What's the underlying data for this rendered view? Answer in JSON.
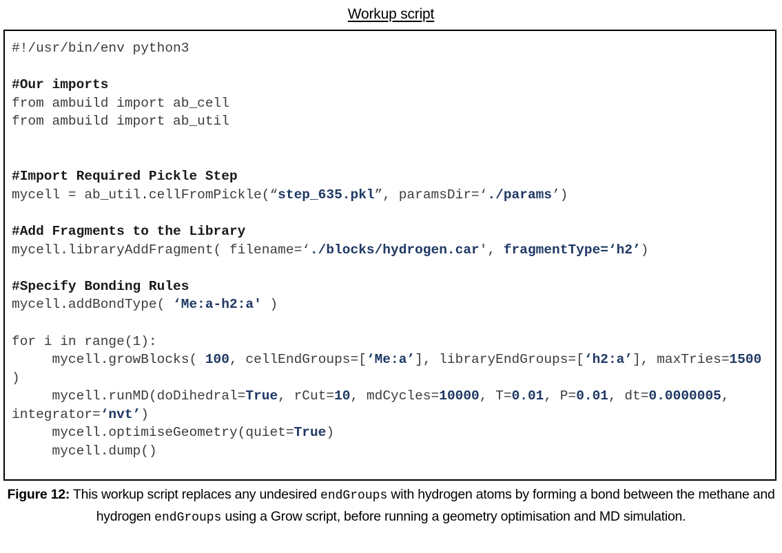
{
  "title": {
    "text": "Workup script"
  },
  "colors": {
    "highlight": "#1f3864",
    "code_text": "#3c3c3c",
    "comment": "#1a1a1a",
    "border": "#000000",
    "background": "#ffffff"
  },
  "code": {
    "language": "python",
    "lines": [
      {
        "id": "shebang",
        "segments": [
          {
            "t": "#!/usr/bin/env python3",
            "s": "plain"
          }
        ]
      },
      {
        "id": "blank-1",
        "segments": []
      },
      {
        "id": "comment-imports",
        "segments": [
          {
            "t": "#Our imports",
            "s": "comment"
          }
        ]
      },
      {
        "id": "import-ab-cell",
        "segments": [
          {
            "t": "from ambuild import ab_cell",
            "s": "plain"
          }
        ]
      },
      {
        "id": "import-ab-util",
        "segments": [
          {
            "t": "from ambuild import ab_util",
            "s": "plain"
          }
        ]
      },
      {
        "id": "blank-2",
        "segments": []
      },
      {
        "id": "blank-3",
        "segments": []
      },
      {
        "id": "comment-pickle",
        "segments": [
          {
            "t": "#Import Required Pickle Step",
            "s": "comment"
          }
        ]
      },
      {
        "id": "cell-from-pickle",
        "segments": [
          {
            "t": "mycell = ab_util.cellFromPickle(“",
            "s": "plain"
          },
          {
            "t": "step_635.pkl",
            "s": "highlight"
          },
          {
            "t": "”, paramsDir=‘",
            "s": "plain"
          },
          {
            "t": "./params",
            "s": "highlight"
          },
          {
            "t": "’)",
            "s": "plain"
          }
        ]
      },
      {
        "id": "blank-4",
        "segments": []
      },
      {
        "id": "comment-fragments",
        "segments": [
          {
            "t": "#Add Fragments to the Library",
            "s": "comment"
          }
        ]
      },
      {
        "id": "library-add-fragment",
        "segments": [
          {
            "t": "mycell.libraryAddFragment( filename=‘",
            "s": "plain"
          },
          {
            "t": "./blocks/hydrogen.car",
            "s": "highlight"
          },
          {
            "t": "', ",
            "s": "plain"
          },
          {
            "t": "fragmentType=‘h2’",
            "s": "highlight"
          },
          {
            "t": ")",
            "s": "plain"
          }
        ]
      },
      {
        "id": "blank-5",
        "segments": []
      },
      {
        "id": "comment-bonding",
        "segments": [
          {
            "t": "#Specify Bonding Rules",
            "s": "comment"
          }
        ]
      },
      {
        "id": "add-bond-type",
        "segments": [
          {
            "t": "mycell.addBondType( ",
            "s": "plain"
          },
          {
            "t": "‘Me:a-h2:a'",
            "s": "highlight"
          },
          {
            "t": " )",
            "s": "plain"
          }
        ]
      },
      {
        "id": "blank-6",
        "segments": []
      },
      {
        "id": "for-loop",
        "segments": [
          {
            "t": "for i in range(1):",
            "s": "plain"
          }
        ]
      },
      {
        "id": "grow-blocks",
        "segments": [
          {
            "t": "     mycell.growBlocks( ",
            "s": "plain"
          },
          {
            "t": "100",
            "s": "highlight"
          },
          {
            "t": ", cellEndGroups=[",
            "s": "plain"
          },
          {
            "t": "‘Me:a’",
            "s": "highlight"
          },
          {
            "t": "], libraryEndGroups=[",
            "s": "plain"
          },
          {
            "t": "‘h2:a’",
            "s": "highlight"
          },
          {
            "t": "], maxTries=",
            "s": "plain"
          },
          {
            "t": "1500",
            "s": "highlight"
          },
          {
            "t": " )",
            "s": "plain"
          }
        ]
      },
      {
        "id": "run-md",
        "segments": [
          {
            "t": "     mycell.runMD(doDihedral=",
            "s": "plain"
          },
          {
            "t": "True",
            "s": "highlight"
          },
          {
            "t": ", rCut=",
            "s": "plain"
          },
          {
            "t": "10",
            "s": "highlight"
          },
          {
            "t": ", mdCycles=",
            "s": "plain"
          },
          {
            "t": "10000",
            "s": "highlight"
          },
          {
            "t": ", T=",
            "s": "plain"
          },
          {
            "t": "0.01",
            "s": "highlight"
          },
          {
            "t": ", P=",
            "s": "plain"
          },
          {
            "t": "0.01",
            "s": "highlight"
          },
          {
            "t": ", dt=",
            "s": "plain"
          },
          {
            "t": "0.0000005",
            "s": "highlight"
          },
          {
            "t": ", integrator=",
            "s": "plain"
          },
          {
            "t": "‘nvt’",
            "s": "highlight"
          },
          {
            "t": ")",
            "s": "plain"
          }
        ]
      },
      {
        "id": "optimise-geometry",
        "segments": [
          {
            "t": "     mycell.optimiseGeometry(quiet=",
            "s": "plain"
          },
          {
            "t": "True",
            "s": "highlight"
          },
          {
            "t": ")",
            "s": "plain"
          }
        ]
      },
      {
        "id": "dump",
        "segments": [
          {
            "t": "     mycell.dump()",
            "s": "plain"
          }
        ]
      }
    ]
  },
  "caption": {
    "segments": [
      {
        "t": "Figure 12:",
        "s": "bold"
      },
      {
        "t": " This workup script replaces any undesired ",
        "s": "plain"
      },
      {
        "t": "endGroups",
        "s": "mono"
      },
      {
        "t": " with hydrogen atoms by forming a bond between the methane and hydrogen ",
        "s": "plain"
      },
      {
        "t": "endGroups",
        "s": "mono"
      },
      {
        "t": " using a Grow script, before running a geometry optimisation and MD simulation.",
        "s": "plain"
      }
    ]
  }
}
